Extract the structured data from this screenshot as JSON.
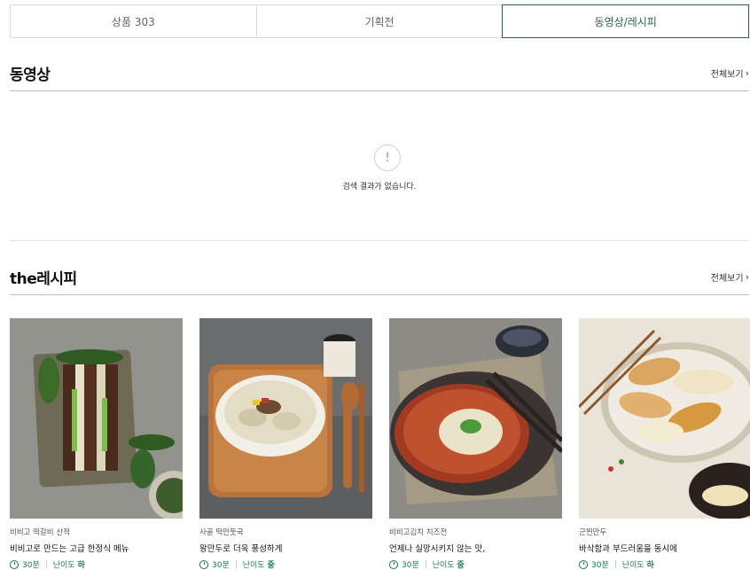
{
  "tabs": [
    {
      "label": "상품 303",
      "active": false
    },
    {
      "label": "기획전",
      "active": false
    },
    {
      "label": "동영상/레시피",
      "active": true
    }
  ],
  "video_section": {
    "title": "동영상",
    "more_label": "전체보기",
    "empty_icon": "!",
    "empty_message": "검색 결과가 없습니다."
  },
  "recipe_section": {
    "title": "the레시피",
    "more_label": "전체보기",
    "items": [
      {
        "category": "비비고 떡갈비 산적",
        "title": "비비고로 만드는 고급 한정식 메뉴",
        "time": "30분",
        "difficulty_label": "난이도",
        "difficulty": "하"
      },
      {
        "category": "사골 떡만둣국",
        "title": "왕만두로 더욱 풍성하게",
        "time": "30분",
        "difficulty_label": "난이도",
        "difficulty": "중"
      },
      {
        "category": "비비고김치 치즈전",
        "title": "언제나 실망시키지 않는 맛,",
        "time": "30분",
        "difficulty_label": "난이도",
        "difficulty": "중"
      },
      {
        "category": "군찐만두",
        "title": "바삭함과 부드러움을 동시에",
        "time": "30분",
        "difficulty_label": "난이도",
        "difficulty": "하"
      }
    ]
  },
  "colors": {
    "accent": "#2e5e4e",
    "meta": "#1b7a4f"
  }
}
